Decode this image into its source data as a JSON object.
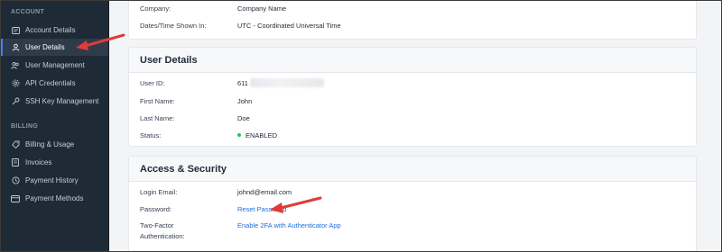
{
  "sidebar": {
    "account_label": "ACCOUNT",
    "billing_label": "BILLING",
    "account_items": [
      {
        "label": "Account Details",
        "icon": "id-card-icon"
      },
      {
        "label": "User Details",
        "icon": "user-icon",
        "active": true
      },
      {
        "label": "User Management",
        "icon": "users-icon"
      },
      {
        "label": "API Credentials",
        "icon": "gear-icon"
      },
      {
        "label": "SSH Key Management",
        "icon": "key-icon"
      }
    ],
    "billing_items": [
      {
        "label": "Billing & Usage",
        "icon": "billing-icon"
      },
      {
        "label": "Invoices",
        "icon": "invoice-icon"
      },
      {
        "label": "Payment History",
        "icon": "history-icon"
      },
      {
        "label": "Payment Methods",
        "icon": "card-icon"
      }
    ]
  },
  "company_card": {
    "rows": [
      {
        "label": "Company:",
        "value": "Company Name"
      },
      {
        "label": "Dates/Time Shown In:",
        "value": "UTC - Coordinated Universal Time"
      }
    ]
  },
  "user_details": {
    "title": "User Details",
    "user_id_label": "User ID:",
    "user_id_value": "611",
    "first_name_label": "First Name:",
    "first_name_value": "John",
    "last_name_label": "Last Name:",
    "last_name_value": "Doe",
    "status_label": "Status:",
    "status_value": "ENABLED",
    "status_color": "#22c55e"
  },
  "access_security": {
    "title": "Access & Security",
    "login_email_label": "Login Email:",
    "login_email_value": "johnd@email.com",
    "password_label": "Password:",
    "password_link": "Reset Password",
    "twofa_label_line1": "Two-Factor",
    "twofa_label_line2": "Authentication:",
    "twofa_link": "Enable 2FA with Authenticator App"
  },
  "colors": {
    "sidebar_bg": "#1f2a37",
    "accent": "#3b82f6",
    "link": "#1d6fd8",
    "arrow": "#e03a3a"
  }
}
